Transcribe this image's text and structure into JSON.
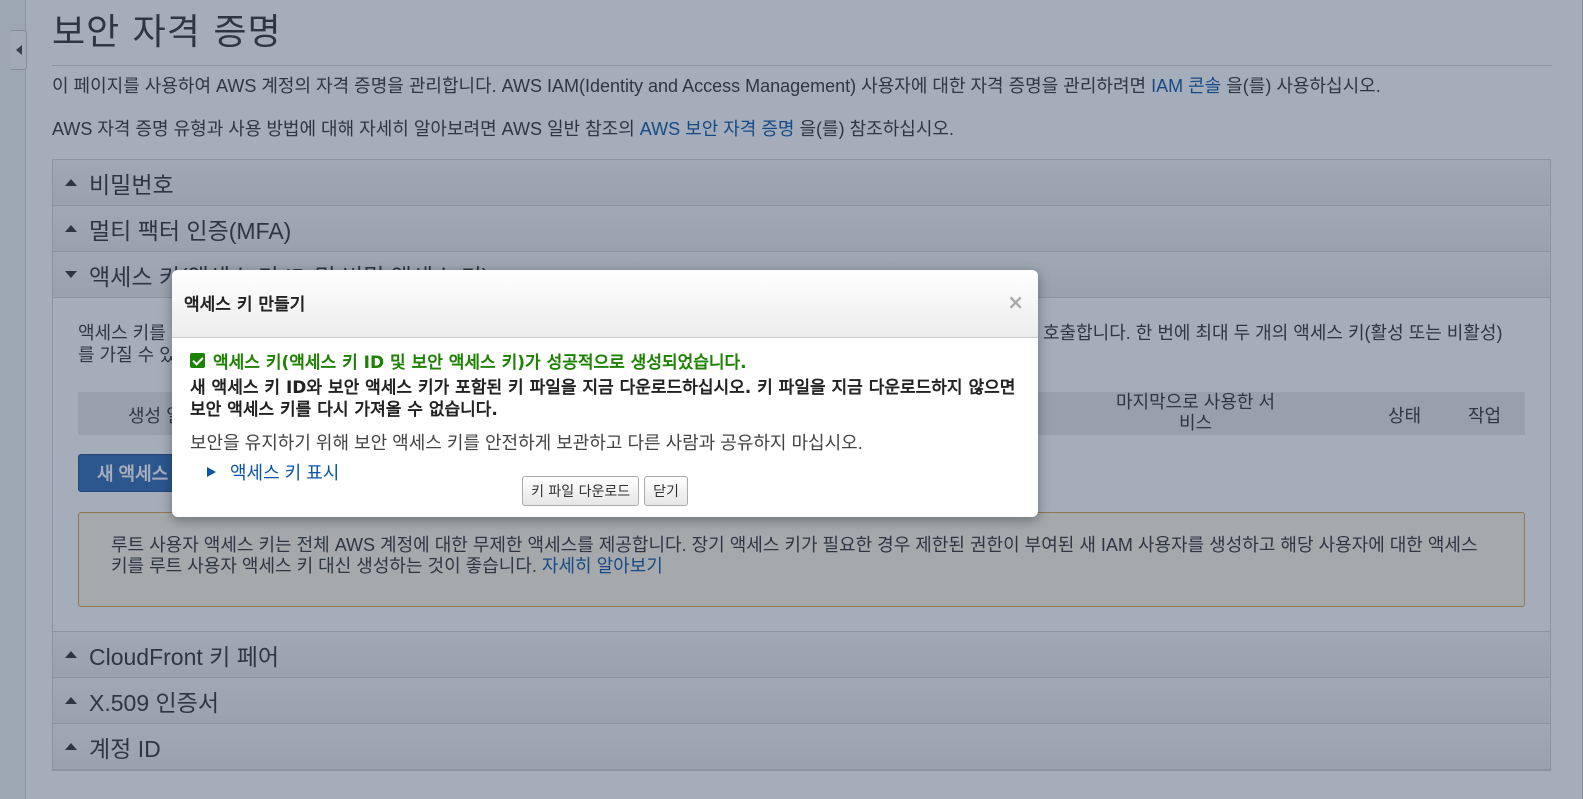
{
  "page": {
    "title": "보안 자격 증명",
    "intro_line1_prefix": "이 페이지를 사용하여 AWS 계정의 자격 증명을 관리합니다. AWS IAM(Identity and Access Management) 사용자에 대한 자격 증명을 관리하려면 ",
    "intro_line1_link": "IAM 콘솔",
    "intro_line1_suffix": " 을(를) 사용하십시오.",
    "intro_line2_prefix": "AWS 자격 증명 유형과 사용 방법에 대해 자세히 알아보려면 AWS 일반 참조의 ",
    "intro_line2_link": "AWS 보안 자격 증명",
    "intro_line2_suffix": " 을(를) 참조하십시오."
  },
  "sections": {
    "password": "비밀번호",
    "mfa": "멀티 팩터 인증(MFA)",
    "access_keys": "액세스 키(액세스 키 ID 및 비밀 액세스 키)",
    "cloudfront": "CloudFront 키 페어",
    "x509": "X.509 인증서",
    "account_id": "계정 ID"
  },
  "access_keys": {
    "desc_left": "액세스 키를",
    "desc_right": "호출합니다. 한 번에 최대 두 개의 액세스 키(활성 또는 비활성)",
    "desc_line2": "를 가질 수 있",
    "table_headers": {
      "created": "생성 일",
      "last_service": "마지막으로 사용한 서비스",
      "status": "상태",
      "action": "작업"
    },
    "new_key_button": "새 액세스 키 만들기",
    "warning_text": "루트 사용자 액세스 키는 전체 AWS 계정에 대한 무제한 액세스를 제공합니다. 장기 액세스 키가 필요한 경우 제한된 권한이 부여된 새 IAM 사용자를 생성하고 해당 사용자에 대한 액세스 키를 루트 사용자 액세스 키 대신 생성하는 것이 좋습니다. ",
    "warning_link": "자세히 알아보기"
  },
  "modal": {
    "title": "액세스 키 만들기",
    "close_symbol": "×",
    "success_message": "액세스 키(액세스 키 ID 및 보안 액세스 키)가 성공적으로 생성되었습니다.",
    "download_warning": "새 액세스 키 ID와 보안 액세스 키가 포함된 키 파일을 지금 다운로드하십시오. 키 파일을 지금 다운로드하지 않으면 보안 액세스 키를 다시 가져올 수 없습니다.",
    "security_note": "보안을 유지하기 위해 보안 액세스 키를 안전하게 보관하고 다른 사람과 공유하지 마십시오.",
    "show_key_link": "액세스 키 표시",
    "download_button": "키 파일 다운로드",
    "close_button": "닫기"
  },
  "colors": {
    "link": "#0a55a8",
    "success": "#1d8102",
    "primary_button": "#2e6ab3",
    "warning_border": "#e0a34a"
  }
}
